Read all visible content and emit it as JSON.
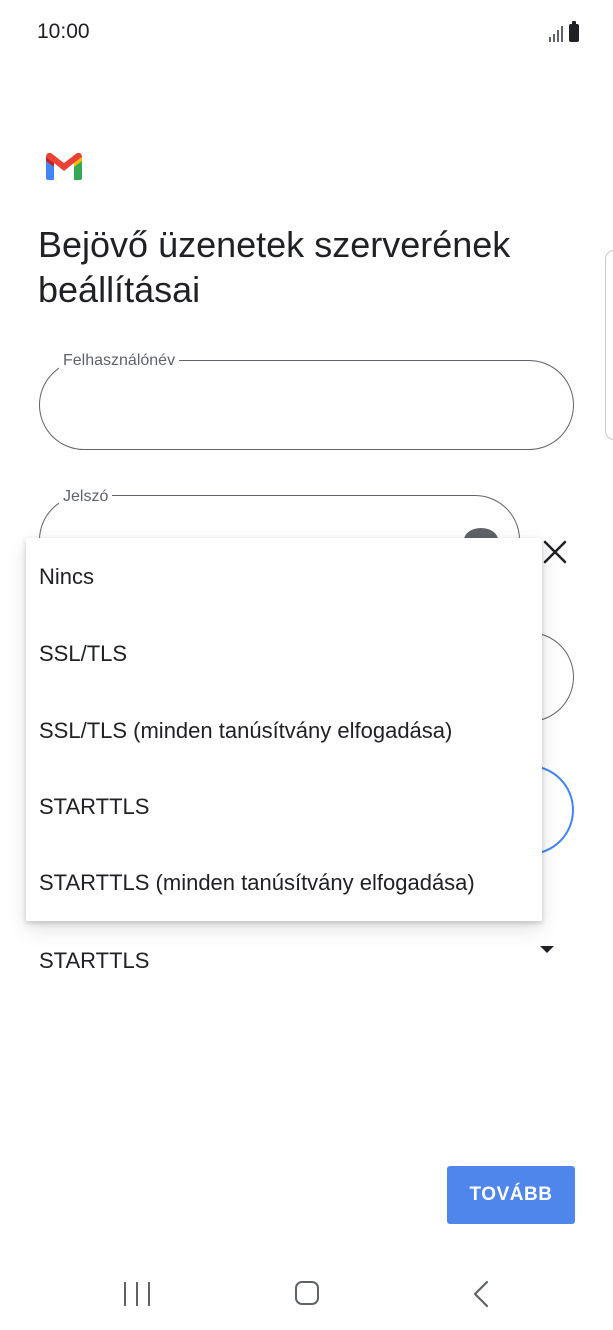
{
  "status_bar": {
    "time": "10:00"
  },
  "page": {
    "title": "Bejövő üzenetek szerverének beállításai"
  },
  "fields": {
    "username_label": "Felhasználónév",
    "password_label": "Jelszó"
  },
  "security": {
    "selected_value": "STARTTLS"
  },
  "menu": {
    "items": [
      {
        "label": "Nincs"
      },
      {
        "label": "SSL/TLS"
      },
      {
        "label": "SSL/TLS (minden tanúsítvány elfogadása)"
      },
      {
        "label": "STARTTLS"
      },
      {
        "label": "STARTTLS (minden tanúsítvány elfogadása)"
      }
    ]
  },
  "buttons": {
    "next_label": "TOVÁBB"
  },
  "colors": {
    "accent": "#4f86ec",
    "field_border": "#5f6368",
    "focus_border": "#4285f4"
  },
  "icons": {
    "logo": "gmail-logo",
    "clear": "close-icon",
    "password_toggle": "eye-icon",
    "dropdown": "dropdown-arrow-icon"
  }
}
